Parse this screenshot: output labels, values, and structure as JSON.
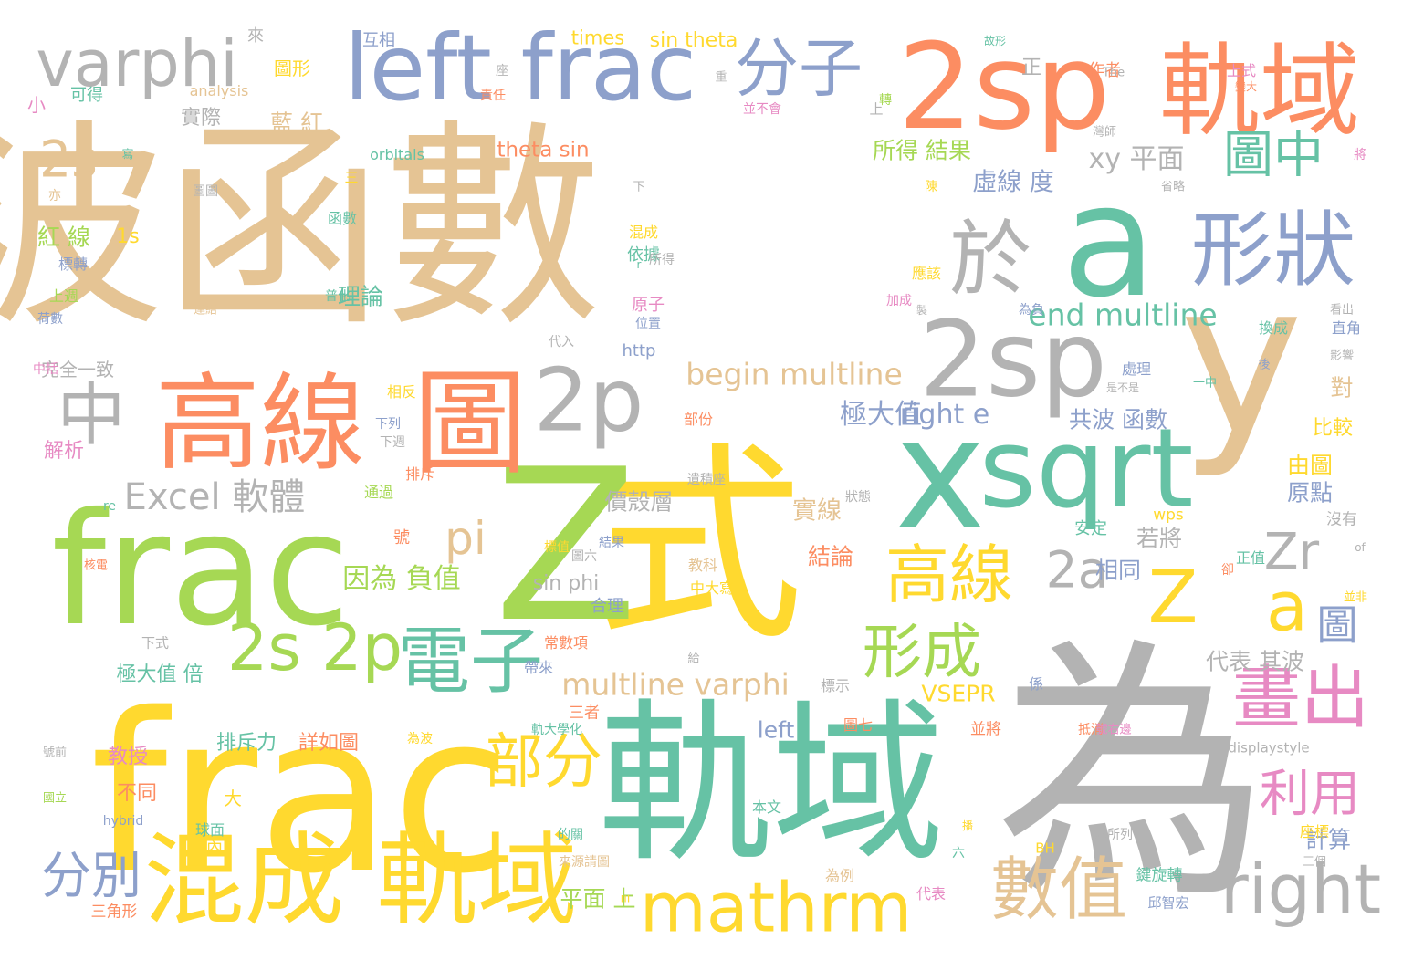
{
  "cloud": {
    "palette": {
      "green": "#66c2a5",
      "orange": "#fc8d62",
      "blue": "#8da0cb",
      "pink": "#e78ac3",
      "lime": "#a6d854",
      "yellow": "#ffd92f",
      "tan": "#e5c494",
      "gray": "#b3b3b3"
    },
    "words": [
      {
        "t": "波函數",
        "c": "tan",
        "w": "big"
      },
      {
        "t": "式",
        "c": "yellow",
        "w": "big"
      },
      {
        "t": "為",
        "c": "gray",
        "w": "big"
      },
      {
        "t": "frac",
        "c": "yellow",
        "w": "big"
      },
      {
        "t": "frac",
        "c": "lime",
        "w": "big"
      },
      {
        "t": "軌域",
        "c": "green",
        "w": "big"
      },
      {
        "t": "Z",
        "c": "lime",
        "w": "big"
      },
      {
        "t": "y",
        "c": "tan",
        "w": "big"
      },
      {
        "t": "a",
        "c": "green",
        "w": "big"
      },
      {
        "t": "x",
        "c": "green",
        "w": "big"
      },
      {
        "t": "2sp",
        "c": "orange",
        "w": "big"
      },
      {
        "t": "軌域",
        "c": "orange",
        "w": "big"
      },
      {
        "t": "left frac",
        "c": "blue",
        "w": "big"
      },
      {
        "t": "varphi",
        "c": "gray",
        "w": "big"
      },
      {
        "t": "sqrt",
        "c": "green",
        "w": "big"
      },
      {
        "t": "高線",
        "c": "orange",
        "w": "big"
      },
      {
        "t": "圖",
        "c": "orange",
        "w": "big"
      },
      {
        "t": "2sp",
        "c": "gray",
        "w": "big"
      },
      {
        "t": "形狀",
        "c": "blue",
        "w": "big"
      },
      {
        "t": "於",
        "c": "gray",
        "w": "big"
      },
      {
        "t": "混成 軌域",
        "c": "yellow",
        "w": "big"
      },
      {
        "t": "分子",
        "c": "blue",
        "w": "mid"
      },
      {
        "t": "2p",
        "c": "gray",
        "w": "big"
      },
      {
        "t": "中",
        "c": "gray",
        "w": "mid"
      },
      {
        "t": "Z",
        "c": "yellow",
        "w": "mid"
      },
      {
        "t": "a",
        "c": "yellow",
        "w": "mid"
      },
      {
        "t": "right",
        "c": "gray",
        "w": "mid"
      },
      {
        "t": "數值",
        "c": "tan",
        "w": "mid"
      },
      {
        "t": "mathrm",
        "c": "yellow",
        "w": "mid"
      },
      {
        "t": "畫出",
        "c": "pink",
        "w": "mid"
      },
      {
        "t": "2s 2p",
        "c": "lime",
        "w": "mid"
      },
      {
        "t": "電子",
        "c": "green",
        "w": "mid"
      },
      {
        "t": "高線",
        "c": "yellow",
        "w": "mid"
      },
      {
        "t": "形成",
        "c": "lime",
        "w": "mid"
      },
      {
        "t": "部分",
        "c": "yellow",
        "w": "mid"
      },
      {
        "t": "分別",
        "c": "blue",
        "w": "mid"
      },
      {
        "t": "利用",
        "c": "pink",
        "w": "mid"
      },
      {
        "t": "2s",
        "c": "tan",
        "w": "mid"
      },
      {
        "t": "圖中",
        "c": "green",
        "w": "mid"
      },
      {
        "t": "Zr",
        "c": "gray",
        "w": "mid"
      },
      {
        "t": "2a",
        "c": "gray",
        "w": "mid"
      },
      {
        "t": "pi",
        "c": "tan",
        "w": "mid"
      },
      {
        "t": "Excel 軟體",
        "c": "gray",
        "w": "mid"
      },
      {
        "t": "圖",
        "c": "blue",
        "w": "mid"
      },
      {
        "t": "begin multline",
        "c": "tan",
        "w": "sm"
      },
      {
        "t": "end multline",
        "c": "green",
        "w": "sm"
      },
      {
        "t": "multline varphi",
        "c": "tan",
        "w": "sm"
      },
      {
        "t": "xy 平面",
        "c": "gray",
        "w": "sm"
      },
      {
        "t": "right e",
        "c": "blue",
        "w": "sm"
      },
      {
        "t": "極大值",
        "c": "blue",
        "w": "sm"
      },
      {
        "t": "共波 函數",
        "c": "blue",
        "w": "sm"
      },
      {
        "t": "價殼層",
        "c": "gray",
        "w": "sm"
      },
      {
        "t": "理論",
        "c": "green",
        "w": "sm"
      },
      {
        "t": "虛線 度",
        "c": "blue",
        "w": "sm"
      },
      {
        "t": "所得 結果",
        "c": "lime",
        "w": "sm"
      },
      {
        "t": "theta sin",
        "c": "orange",
        "w": "sm"
      },
      {
        "t": "sin theta",
        "c": "yellow",
        "w": "sm"
      },
      {
        "t": "times",
        "c": "yellow",
        "w": "sm"
      },
      {
        "t": "藍 紅",
        "c": "tan",
        "w": "sm"
      },
      {
        "t": "紅 線",
        "c": "lime",
        "w": "sm"
      },
      {
        "t": "1s",
        "c": "yellow",
        "w": "sm"
      },
      {
        "t": "因為 負值",
        "c": "lime",
        "w": "sm"
      },
      {
        "t": "相同",
        "c": "blue",
        "w": "sm"
      },
      {
        "t": "若將",
        "c": "gray",
        "w": "sm"
      },
      {
        "t": "結論",
        "c": "orange",
        "w": "sm"
      },
      {
        "t": "實線",
        "c": "tan",
        "w": "sm"
      },
      {
        "t": "VSEPR",
        "c": "yellow",
        "w": "sm"
      },
      {
        "t": "代表 其波",
        "c": "gray",
        "w": "sm"
      },
      {
        "t": "極大值 倍",
        "c": "green",
        "w": "sm"
      },
      {
        "t": "left",
        "c": "blue",
        "w": "sm"
      },
      {
        "t": "平面 上",
        "c": "lime",
        "w": "sm"
      },
      {
        "t": "計算",
        "c": "blue",
        "w": "sm"
      },
      {
        "t": "原點",
        "c": "blue",
        "w": "sm"
      },
      {
        "t": "由圖",
        "c": "yellow",
        "w": "sm"
      },
      {
        "t": "對",
        "c": "tan",
        "w": "sm"
      },
      {
        "t": "比較",
        "c": "yellow",
        "w": "sm"
      },
      {
        "t": "sin phi",
        "c": "gray",
        "w": "sm"
      },
      {
        "t": "排斥力",
        "c": "green",
        "w": "sm"
      },
      {
        "t": "詳如圖",
        "c": "orange",
        "w": "sm"
      },
      {
        "t": "教授",
        "c": "pink",
        "w": "sm"
      },
      {
        "t": "不同",
        "c": "orange",
        "w": "sm"
      },
      {
        "t": "解析",
        "c": "pink",
        "w": "sm"
      },
      {
        "t": "完全一致",
        "c": "gray",
        "w": "sm"
      },
      {
        "t": "實際",
        "c": "gray",
        "w": "sm"
      },
      {
        "t": "正",
        "c": "gray",
        "w": "sm"
      },
      {
        "t": "小",
        "c": "pink",
        "w": "sm"
      },
      {
        "t": "圖形",
        "c": "yellow",
        "w": "sm"
      },
      {
        "t": "互相",
        "c": "blue",
        "w": "xs"
      },
      {
        "t": "來",
        "c": "gray",
        "w": "xs"
      },
      {
        "t": "可得",
        "c": "green",
        "w": "xs"
      },
      {
        "t": "analysis",
        "c": "tan",
        "w": "xs"
      },
      {
        "t": "orbitals",
        "c": "green",
        "w": "xs"
      },
      {
        "t": "作者",
        "c": "orange",
        "w": "xs"
      },
      {
        "t": "上式",
        "c": "pink",
        "w": "xs"
      },
      {
        "t": "The",
        "c": "gray",
        "w": "xs"
      },
      {
        "t": "原子",
        "c": "pink",
        "w": "xs"
      },
      {
        "t": "http",
        "c": "blue",
        "w": "xs"
      },
      {
        "t": "依據",
        "c": "green",
        "w": "xs"
      },
      {
        "t": "混成",
        "c": "yellow",
        "w": "xs"
      },
      {
        "t": "合理",
        "c": "blue",
        "w": "xs"
      },
      {
        "t": "常數項",
        "c": "orange",
        "w": "xs"
      },
      {
        "t": "中大寫",
        "c": "yellow",
        "w": "xs"
      },
      {
        "t": "wps",
        "c": "yellow",
        "w": "xs"
      },
      {
        "t": "沒有",
        "c": "gray",
        "w": "xs"
      },
      {
        "t": "安定",
        "c": "green",
        "w": "xs"
      },
      {
        "t": "正值",
        "c": "green",
        "w": "xs"
      },
      {
        "t": "displaystyle",
        "c": "gray",
        "w": "xs"
      },
      {
        "t": "hybrid",
        "c": "blue",
        "w": "xs"
      },
      {
        "t": "鍵旋轉",
        "c": "green",
        "w": "xs"
      },
      {
        "t": "邱智宏",
        "c": "blue",
        "w": "xs"
      },
      {
        "t": "三角形",
        "c": "orange",
        "w": "xs"
      },
      {
        "t": "球面",
        "c": "green",
        "w": "xs"
      },
      {
        "t": "代表",
        "c": "pink",
        "w": "xs"
      },
      {
        "t": "為例",
        "c": "tan",
        "w": "xs"
      },
      {
        "t": "座標",
        "c": "yellow",
        "w": "xs"
      },
      {
        "t": "三者",
        "c": "orange",
        "w": "xs"
      },
      {
        "t": "圖七",
        "c": "orange",
        "w": "xs"
      },
      {
        "t": "標示",
        "c": "gray",
        "w": "xs"
      },
      {
        "t": "BH",
        "c": "yellow",
        "w": "xs"
      },
      {
        "t": "六所列",
        "c": "gray",
        "w": "xs"
      },
      {
        "t": "本文",
        "c": "green",
        "w": "xs"
      },
      {
        "t": "教科",
        "c": "tan",
        "w": "xs"
      },
      {
        "t": "下式",
        "c": "gray",
        "w": "xs"
      },
      {
        "t": "相反",
        "c": "yellow",
        "w": "xs"
      },
      {
        "t": "排斥",
        "c": "orange",
        "w": "xs"
      },
      {
        "t": "通過",
        "c": "lime",
        "w": "xs"
      },
      {
        "t": "號",
        "c": "orange",
        "w": "xs"
      },
      {
        "t": "部份",
        "c": "orange",
        "w": "xs"
      },
      {
        "t": "直角",
        "c": "blue",
        "w": "xs"
      },
      {
        "t": "換成",
        "c": "green",
        "w": "xs"
      },
      {
        "t": "處理",
        "c": "blue",
        "w": "xs"
      },
      {
        "t": "應該",
        "c": "yellow",
        "w": "xs"
      },
      {
        "t": "為負",
        "c": "blue",
        "w": "xs"
      },
      {
        "t": "陳",
        "c": "yellow",
        "w": "xs"
      },
      {
        "t": "所得",
        "c": "gray",
        "w": "xs"
      },
      {
        "t": "加成",
        "c": "pink",
        "w": "xs"
      },
      {
        "t": "位置",
        "c": "blue",
        "w": "xs"
      },
      {
        "t": "代入",
        "c": "gray",
        "w": "xs"
      },
      {
        "t": "普化",
        "c": "green",
        "w": "xs"
      },
      {
        "t": "函數",
        "c": "green",
        "w": "xs"
      },
      {
        "t": "標轉",
        "c": "blue",
        "w": "xs"
      },
      {
        "t": "上週",
        "c": "lime",
        "w": "xs"
      },
      {
        "t": "荷數",
        "c": "blue",
        "w": "xs"
      },
      {
        "t": "連結",
        "c": "tan",
        "w": "xs"
      },
      {
        "t": "中括",
        "c": "pink",
        "w": "xs"
      },
      {
        "t": "圖圖",
        "c": "gray",
        "w": "xs"
      },
      {
        "t": "亦",
        "c": "tan",
        "w": "xs"
      },
      {
        "t": "三",
        "c": "yellow",
        "w": "xs"
      },
      {
        "t": "上",
        "c": "gray",
        "w": "xs"
      },
      {
        "t": "並不會",
        "c": "pink",
        "w": "xs"
      },
      {
        "t": "看出",
        "c": "gray",
        "w": "xs"
      },
      {
        "t": "影響",
        "c": "gray",
        "w": "xs"
      },
      {
        "t": "是不是",
        "c": "gray",
        "w": "xs"
      },
      {
        "t": "一中",
        "c": "green",
        "w": "xs"
      },
      {
        "t": "後",
        "c": "blue",
        "w": "xs"
      },
      {
        "t": "圖六",
        "c": "gray",
        "w": "xs"
      },
      {
        "t": "狀態",
        "c": "gray",
        "w": "xs"
      },
      {
        "t": "標值",
        "c": "yellow",
        "w": "xs"
      },
      {
        "t": "結果",
        "c": "blue",
        "w": "xs"
      },
      {
        "t": "下列",
        "c": "blue",
        "w": "xs"
      },
      {
        "t": "下週",
        "c": "gray",
        "w": "xs"
      },
      {
        "t": "re",
        "c": "green",
        "w": "xs"
      },
      {
        "t": "核電",
        "c": "orange",
        "w": "xs"
      },
      {
        "t": "國立",
        "c": "lime",
        "w": "xs"
      },
      {
        "t": "號前",
        "c": "gray",
        "w": "xs"
      },
      {
        "t": "of",
        "c": "gray",
        "w": "xs"
      },
      {
        "t": "並非",
        "c": "yellow",
        "w": "xs"
      },
      {
        "t": "卻",
        "c": "orange",
        "w": "xs"
      },
      {
        "t": "抵消",
        "c": "orange",
        "w": "xs"
      },
      {
        "t": "號右邊",
        "c": "pink",
        "w": "xs"
      },
      {
        "t": "三個",
        "c": "gray",
        "w": "xs"
      },
      {
        "t": "將",
        "c": "pink",
        "w": "xs"
      },
      {
        "t": "省略",
        "c": "gray",
        "w": "xs"
      },
      {
        "t": "灣師",
        "c": "gray",
        "w": "xs"
      },
      {
        "t": "變大",
        "c": "orange",
        "w": "xs"
      },
      {
        "t": "故形",
        "c": "green",
        "w": "xs"
      },
      {
        "t": "座",
        "c": "gray",
        "w": "xs"
      },
      {
        "t": "重",
        "c": "gray",
        "w": "xs"
      },
      {
        "t": "責任",
        "c": "orange",
        "w": "xs"
      },
      {
        "t": "寫",
        "c": "green",
        "w": "xs"
      },
      {
        "t": "轉",
        "c": "lime",
        "w": "xs"
      },
      {
        "t": "來源請圖",
        "c": "tan",
        "w": "xs"
      },
      {
        "t": "的關",
        "c": "green",
        "w": "xs"
      },
      {
        "t": "帶來",
        "c": "blue",
        "w": "xs"
      },
      {
        "t": "給",
        "c": "gray",
        "w": "xs"
      },
      {
        "t": "軌大學化",
        "c": "green",
        "w": "xs"
      },
      {
        "t": "為波",
        "c": "yellow",
        "w": "xs"
      },
      {
        "t": "係",
        "c": "blue",
        "w": "xs"
      },
      {
        "t": "六",
        "c": "green",
        "w": "xs"
      },
      {
        "t": "大",
        "c": "yellow",
        "w": "xs"
      },
      {
        "t": "內",
        "c": "yellow",
        "w": "sm"
      },
      {
        "t": "並將",
        "c": "orange",
        "w": "sm"
      },
      {
        "t": "製",
        "c": "gray",
        "w": "sm"
      },
      {
        "t": "下",
        "c": "gray",
        "w": "xs"
      },
      {
        "t": "r",
        "c": "green",
        "w": "xs"
      },
      {
        "t": "ııı",
        "c": "yellow",
        "w": "xs"
      },
      {
        "t": "播",
        "c": "yellow",
        "w": "xs"
      },
      {
        "t": "遺積座",
        "c": "gray",
        "w": "xs"
      }
    ]
  }
}
